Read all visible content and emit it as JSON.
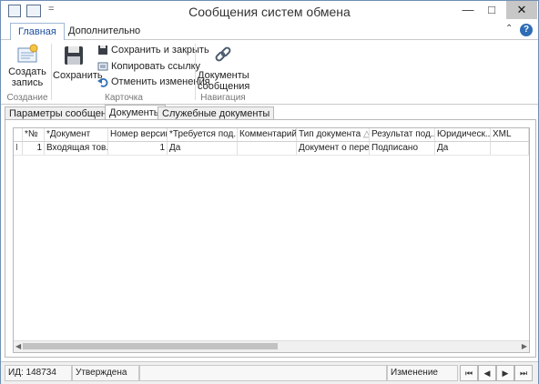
{
  "window": {
    "title": "Сообщения систем обмена",
    "quick_access": {
      "dropdown": "="
    },
    "controls": {
      "minimize": "—",
      "maximize": "□",
      "close": "✕"
    }
  },
  "ribbon": {
    "tabs": [
      "Главная",
      "Дополнительно"
    ],
    "create_record": "Создать запись",
    "save": "Сохранить",
    "save_close": "Сохранить и закрыть",
    "copy_link": "Копировать ссылку",
    "undo": "Отменить изменения",
    "documents": "Документы сообщения",
    "groups": {
      "create": "Создание",
      "card": "Карточка",
      "navigation": "Навигация"
    }
  },
  "form_tabs": [
    "Параметры сообщения",
    "Документы",
    "Служебные документы"
  ],
  "grid": {
    "headers": [
      "*№",
      "*Документ",
      "Номер версии",
      "*Требуется под...",
      "Комментарий",
      "Тип документа",
      "Результат под...",
      "Юридическ...",
      "XML"
    ],
    "sort_indicator": "△",
    "rows": [
      {
        "marker": "I",
        "cells": [
          "1",
          "Входящая тов...",
          "1",
          "Да",
          "",
          "Документ о пере...",
          "Подписано",
          "Да",
          ""
        ]
      }
    ]
  },
  "status": {
    "id": "ИД: 148734",
    "state": "Утверждена",
    "empty": "",
    "mode": "Изменение",
    "nav": [
      "⏮",
      "◀",
      "▶",
      "⏭"
    ]
  },
  "colors": {
    "accent": "#2e6db5",
    "border": "#b8b8b8"
  }
}
